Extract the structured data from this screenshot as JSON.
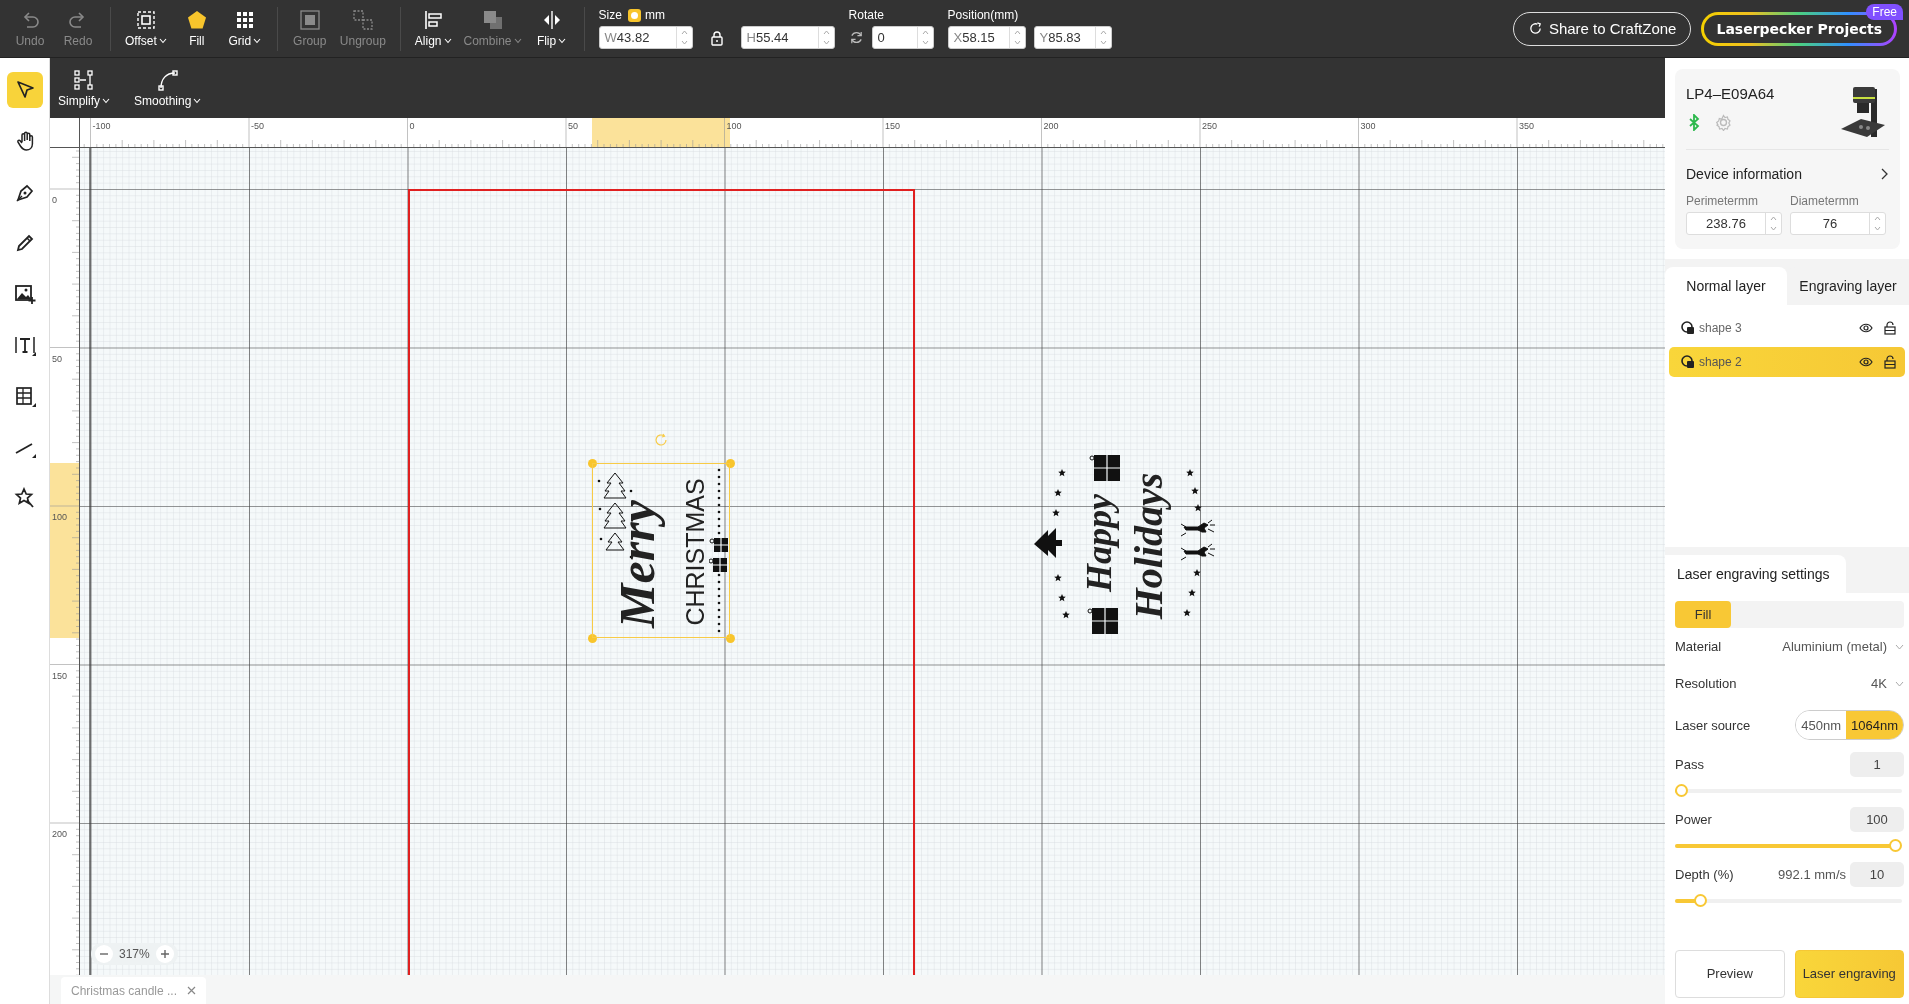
{
  "toolbar": {
    "tool_groups": [
      [
        {
          "label": "Undo",
          "disabled": true,
          "dropdown": false
        },
        {
          "label": "Redo",
          "disabled": true,
          "dropdown": false
        }
      ],
      [
        {
          "label": "Offset",
          "disabled": false,
          "dropdown": true
        },
        {
          "label": "Fill",
          "disabled": false,
          "dropdown": false
        },
        {
          "label": "Grid",
          "disabled": false,
          "dropdown": true
        }
      ],
      [
        {
          "label": "Group",
          "disabled": true,
          "dropdown": false
        },
        {
          "label": "Ungroup",
          "disabled": true,
          "dropdown": false
        }
      ],
      [
        {
          "label": "Align",
          "disabled": false,
          "dropdown": true
        },
        {
          "label": "Combine",
          "disabled": true,
          "dropdown": true
        },
        {
          "label": "Flip",
          "disabled": false,
          "dropdown": true
        }
      ]
    ],
    "size": {
      "label": "Size",
      "unit": "mm",
      "unit_on": true,
      "ratio_locked": true,
      "fields": [
        {
          "prefix": "W",
          "value": "43.82"
        },
        {
          "prefix": "H",
          "value": "55.44"
        }
      ]
    },
    "rotate": {
      "label": "Rotate",
      "fields": [
        {
          "value": "0"
        }
      ]
    },
    "position": {
      "label": "Position(mm)",
      "fields": [
        {
          "prefix": "X",
          "value": "58.15"
        },
        {
          "prefix": "Y",
          "value": "85.83"
        }
      ]
    },
    "share_button": "Share to CraftZone",
    "projects_button": {
      "label": "Laserpecker Projects",
      "badge": "Free"
    }
  },
  "subtoolbar": [
    {
      "label": "Simplify",
      "dropdown": true
    },
    {
      "label": "Smoothing",
      "dropdown": true
    }
  ],
  "left_tools": [
    {
      "selected": true
    },
    {
      "selected": false
    },
    {
      "selected": false
    },
    {
      "selected": false
    },
    {
      "selected": false
    },
    {
      "selected": false
    },
    {
      "selected": false
    },
    {
      "selected": false
    },
    {
      "selected": false
    }
  ],
  "canvas": {
    "top_ruler": [
      "-100",
      "-50",
      "0",
      "50",
      "100",
      "150",
      "200",
      "250",
      "300",
      "350"
    ],
    "left_ruler": [
      "0",
      "50",
      "100",
      "150",
      "200"
    ],
    "artworks": [
      {
        "kind": "merry",
        "lines": [
          "Merry",
          "CHRISTMAS"
        ],
        "selected": true
      },
      {
        "kind": "holidays",
        "lines": [
          "Happy",
          "Holidays"
        ],
        "selected": false
      }
    ],
    "zoom": "317%"
  },
  "document_tabs": [
    {
      "label": "Christmas candle ...",
      "selected": true
    }
  ],
  "device": {
    "name": "LP4–E09A64",
    "connected": true,
    "info_link": "Device information",
    "fields": [
      {
        "label": "Perimetermm",
        "value": "238.76"
      },
      {
        "label": "Diametermm",
        "value": "76"
      }
    ]
  },
  "layer_tabs": [
    {
      "label": "Normal layer",
      "selected": true
    },
    {
      "label": "Engraving layer",
      "selected": false
    }
  ],
  "layers": [
    {
      "name": "shape 3",
      "selected": false,
      "visible": true,
      "locked": false
    },
    {
      "name": "shape 2",
      "selected": true,
      "visible": true,
      "locked": false
    }
  ],
  "settings": {
    "title": "Laser engraving settings",
    "modes": [
      {
        "label": "Fill",
        "selected": true
      }
    ],
    "selects": [
      {
        "label": "Material",
        "value": "Aluminium (metal)"
      },
      {
        "label": "Resolution",
        "value": "4K"
      }
    ],
    "laser_source": {
      "label": "Laser source",
      "options": [
        {
          "label": "450nm",
          "selected": false
        },
        {
          "label": "1064nm",
          "selected": true
        }
      ]
    },
    "sliders": [
      {
        "label": "Pass",
        "value": "1",
        "level": 0
      },
      {
        "label": "Power",
        "value": "100",
        "level": 1
      },
      {
        "label": "Depth (%)",
        "reading": "992.1 mm/s",
        "value": "10",
        "level": 0.09
      }
    ]
  },
  "actions": [
    {
      "label": "Preview",
      "primary": false
    },
    {
      "label": "Laser engraving",
      "primary": true
    }
  ]
}
